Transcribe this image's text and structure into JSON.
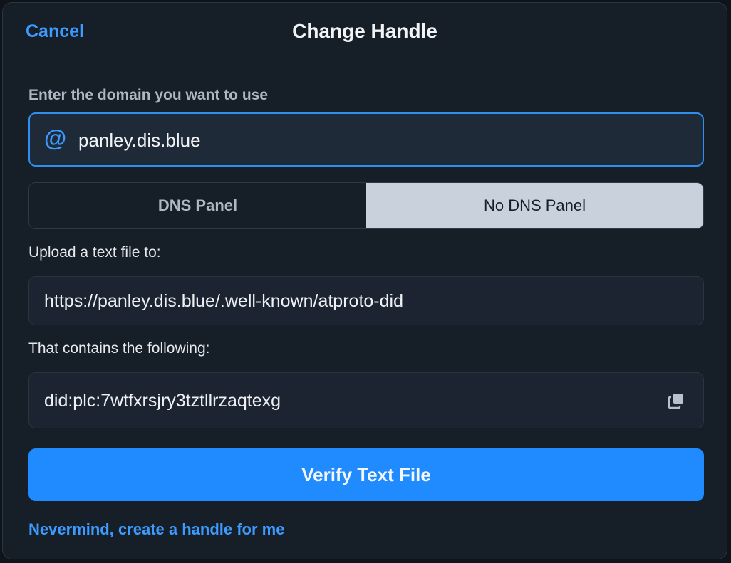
{
  "header": {
    "cancel_label": "Cancel",
    "title": "Change Handle"
  },
  "domain": {
    "label": "Enter the domain you want to use",
    "prefix_icon": "at-sign-icon",
    "value": "panley.dis.blue"
  },
  "toggle": {
    "options": [
      {
        "label": "DNS Panel",
        "selected": false
      },
      {
        "label": "No DNS Panel",
        "selected": true
      }
    ]
  },
  "upload": {
    "label": "Upload a text file to:",
    "url": "https://panley.dis.blue/.well-known/atproto-did"
  },
  "contents": {
    "label": "That contains the following:",
    "value": "did:plc:7wtfxrsjry3tztllrzaqtexg",
    "copy_icon": "copy-icon"
  },
  "actions": {
    "verify_label": "Verify Text File",
    "nevermind_label": "Nevermind, create a handle for me"
  },
  "colors": {
    "accent": "#208bfe",
    "link": "#3d9bff",
    "background": "#161e27"
  }
}
